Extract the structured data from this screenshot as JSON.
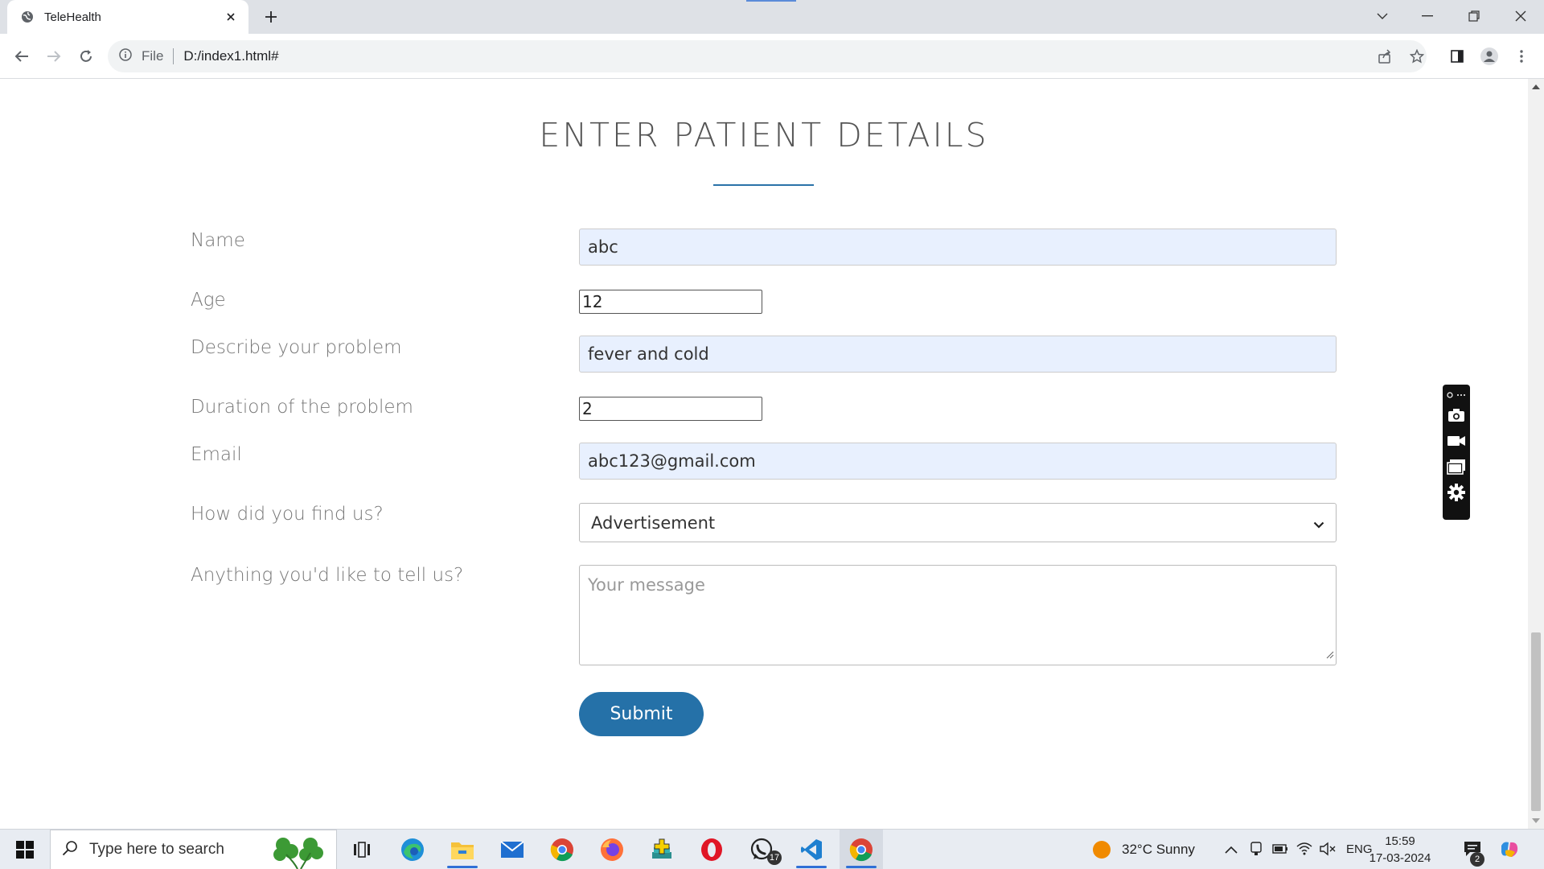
{
  "browser": {
    "tab_title": "TeleHealth",
    "file_label": "File",
    "url": "D:/index1.html#"
  },
  "form": {
    "title": "ENTER PATIENT DETAILS",
    "fields": {
      "name": {
        "label": "Name",
        "value": "abc"
      },
      "age": {
        "label": "Age",
        "value": "12"
      },
      "problem": {
        "label": "Describe your problem",
        "value": "fever and cold"
      },
      "duration": {
        "label": "Duration of the problem",
        "value": "2"
      },
      "email": {
        "label": "Email",
        "value": "abc123@gmail.com"
      },
      "source": {
        "label": "How did you find us?",
        "value": "Advertisement"
      },
      "message": {
        "label": "Anything you'd like to tell us?",
        "placeholder": "Your message"
      }
    },
    "submit_label": "Submit",
    "accent_color": "#2571a8",
    "autofill_color": "#e8f0fe"
  },
  "taskbar": {
    "search_placeholder": "Type here to search",
    "whatsapp_badge": "17",
    "weather": "32°C  Sunny",
    "language": "ENG",
    "time": "15:59",
    "date": "17-03-2024",
    "notification_count": "2"
  }
}
